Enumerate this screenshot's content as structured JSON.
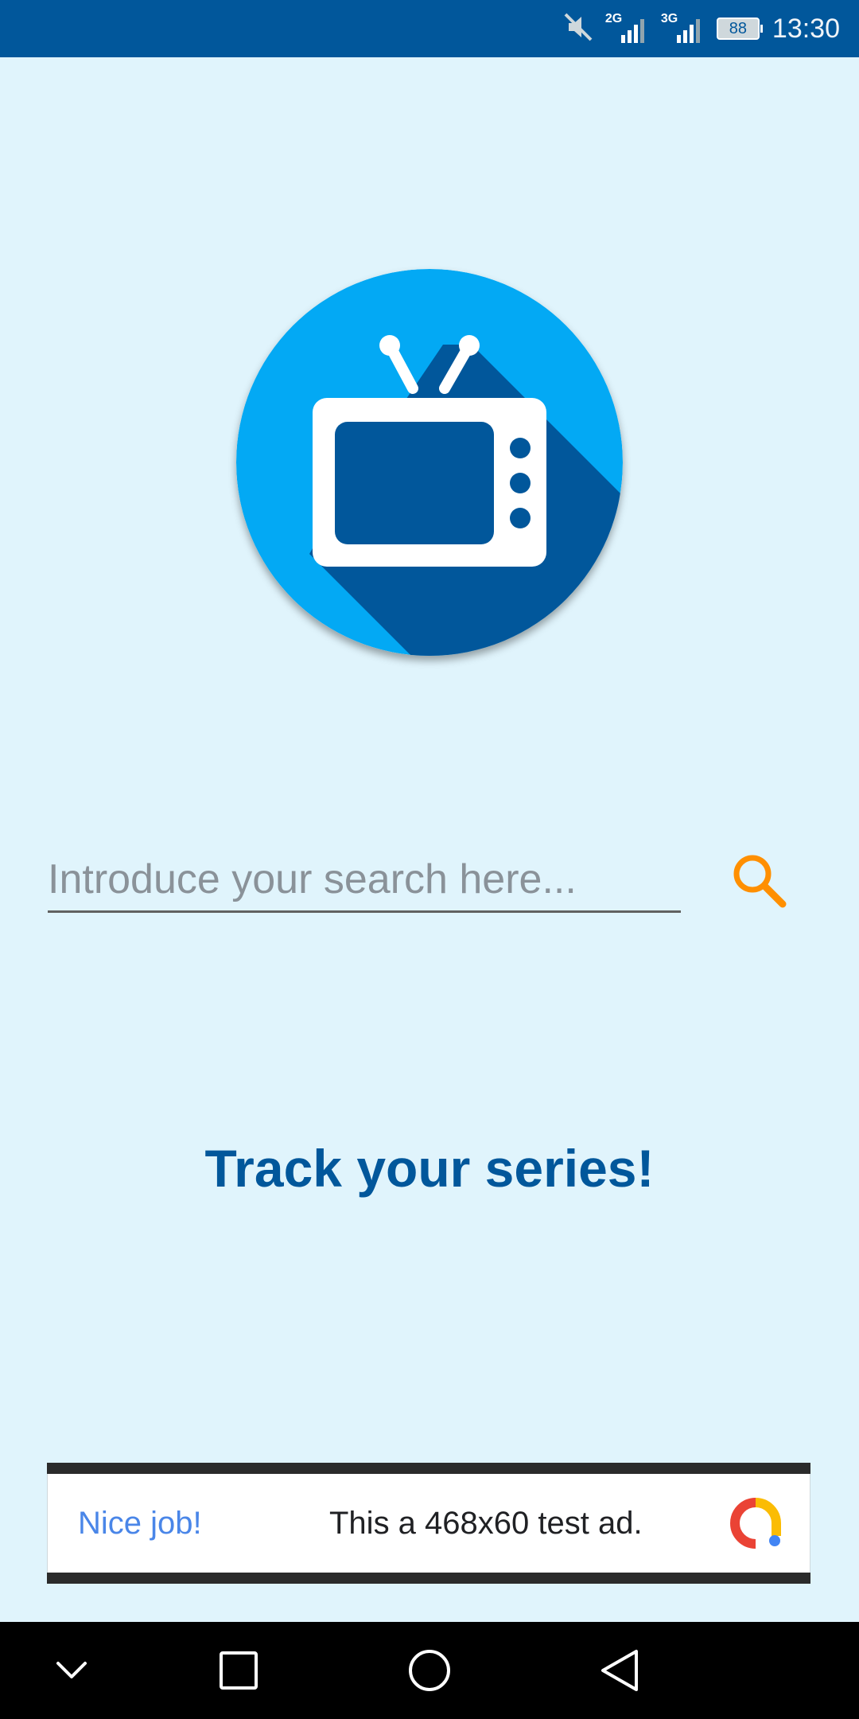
{
  "status_bar": {
    "network_1": "2G",
    "network_2": "3G",
    "battery": "88",
    "time": "13:30",
    "icons": [
      "mute-icon",
      "signal-icon",
      "signal-icon",
      "battery-icon"
    ]
  },
  "logo": {
    "icon": "tv-icon",
    "colors": {
      "circle": "#03a9f4",
      "shadow": "#01579b",
      "tv": "#ffffff"
    }
  },
  "search": {
    "placeholder": "Introduce your search here...",
    "value": "",
    "button_icon": "search-icon",
    "button_color": "#ff8f00"
  },
  "tagline": "Track your series!",
  "ad": {
    "headline": "Nice job!",
    "text": "This a 468x60 test ad.",
    "logo_icon": "ad-logo-icon"
  },
  "nav_bar": {
    "buttons": [
      "chevron-down-icon",
      "recents-icon",
      "home-icon",
      "back-icon"
    ]
  },
  "colors": {
    "background": "#e0f4fc",
    "status_bar": "#01579b",
    "accent": "#01579b"
  }
}
